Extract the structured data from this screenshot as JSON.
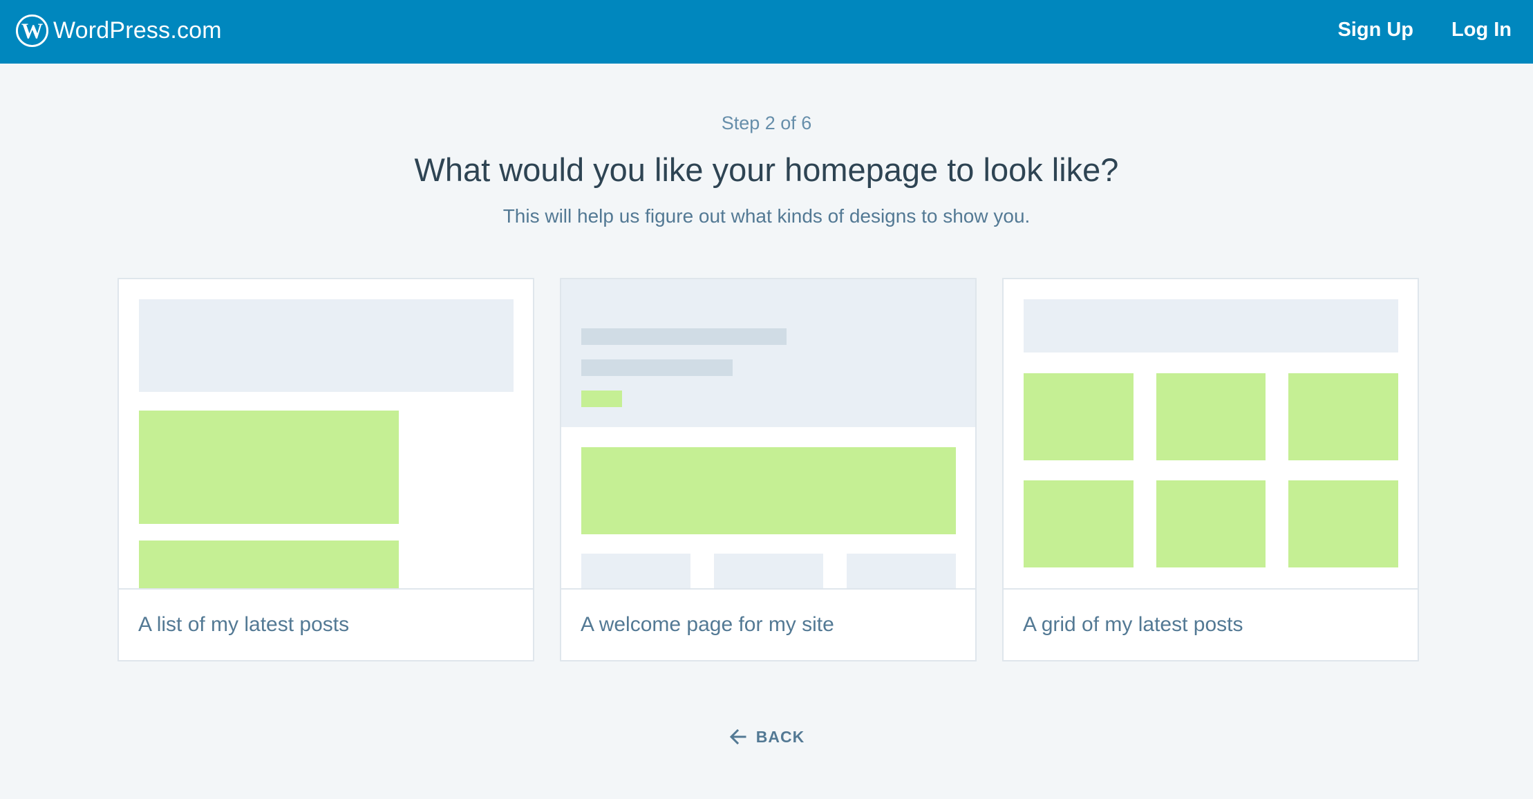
{
  "header": {
    "brand": "WordPress.com",
    "logo_icon": "wordpress-logo-icon",
    "nav": [
      {
        "label": "Sign Up"
      },
      {
        "label": "Log In"
      }
    ],
    "background_color": "#0087be"
  },
  "main": {
    "step": "Step 2 of 6",
    "title": "What would you like your homepage to look like?",
    "subtitle": "This will help us figure out what kinds of designs to show you.",
    "options": [
      {
        "label": "A list of my latest posts"
      },
      {
        "label": "A welcome page for my site"
      },
      {
        "label": "A grid of my latest posts"
      }
    ],
    "back_label": "BACK",
    "back_icon": "arrow-left-icon"
  },
  "colors": {
    "accent": "#0087be",
    "preview_green": "#c5ef94",
    "preview_gray": "#e9eff5",
    "text_muted": "#537994"
  }
}
